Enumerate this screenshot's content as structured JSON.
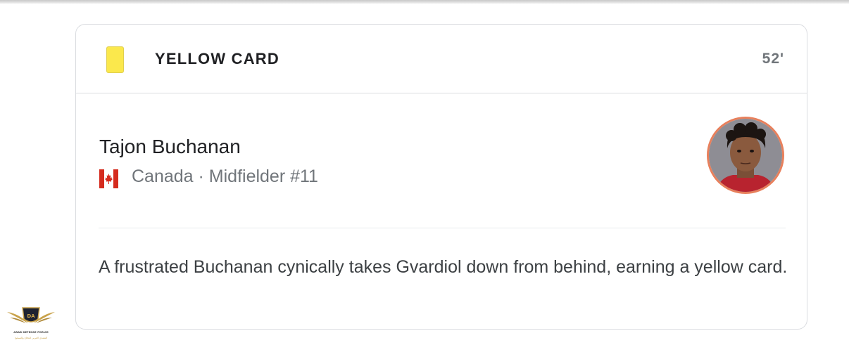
{
  "event": {
    "type_label": "YELLOW CARD",
    "minute": "52'",
    "card_color": "#fbe84c"
  },
  "player": {
    "name": "Tajon Buchanan",
    "country": "Canada",
    "position": "Midfielder #11",
    "meta_line": "Canada · Midfielder #11",
    "flag_icon": "canada-flag-icon",
    "avatar_border_color": "#e8805c"
  },
  "description": "A frustrated Buchanan cynically takes Gvardiol down from behind, earning a yellow card.",
  "watermark": {
    "title": "ARAB DEFENSE FORUM",
    "subtitle": "المنتدى العربي للدفاع والتسليح"
  }
}
